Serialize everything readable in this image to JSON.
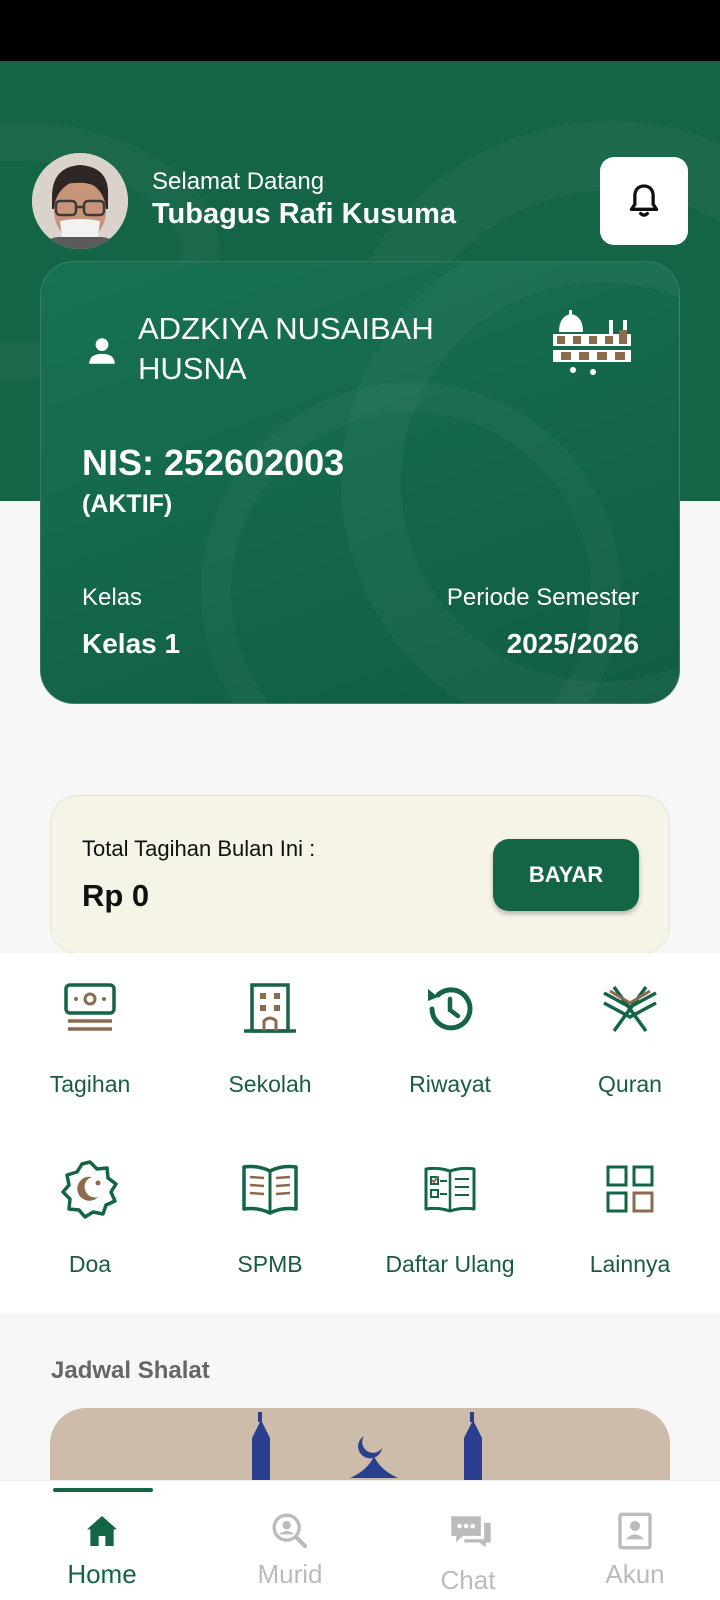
{
  "header": {
    "greeting": "Selamat Datang",
    "user_name": "Tubagus Rafi Kusuma"
  },
  "student_card": {
    "name": "ADZKIYA NUSAIBAH HUSNA",
    "nis": "NIS: 252602003",
    "status": "(AKTIF)",
    "class_label": "Kelas",
    "class_value": "Kelas 1",
    "period_label": "Periode Semester",
    "period_value": "2025/2026"
  },
  "billing": {
    "label": "Total Tagihan Bulan Ini :",
    "amount": "Rp 0",
    "pay_label": "BAYAR"
  },
  "menu": [
    {
      "label": "Tagihan",
      "icon": "bill-icon"
    },
    {
      "label": "Sekolah",
      "icon": "school-building-icon"
    },
    {
      "label": "Riwayat",
      "icon": "history-icon"
    },
    {
      "label": "Quran",
      "icon": "quran-icon"
    },
    {
      "label": "Doa",
      "icon": "crescent-star-badge-icon"
    },
    {
      "label": "SPMB",
      "icon": "open-book-icon"
    },
    {
      "label": "Daftar Ulang",
      "icon": "checklist-book-icon"
    },
    {
      "label": "Lainnya",
      "icon": "grid-icon"
    }
  ],
  "prayer_section": {
    "title": "Jadwal Shalat"
  },
  "bottom_nav": [
    {
      "label": "Home",
      "icon": "home-icon",
      "active": true
    },
    {
      "label": "Murid",
      "icon": "student-search-icon",
      "active": false
    },
    {
      "label": "Chat",
      "icon": "chat-icon",
      "active": false
    },
    {
      "label": "Akun",
      "icon": "account-icon",
      "active": false
    }
  ],
  "colors": {
    "primary": "#146446",
    "accent_brown": "#8b6a4e",
    "bill_bg": "#f6f3e7",
    "prayer_bg": "#cdbca9",
    "mosque_blue": "#2a3f8f"
  }
}
